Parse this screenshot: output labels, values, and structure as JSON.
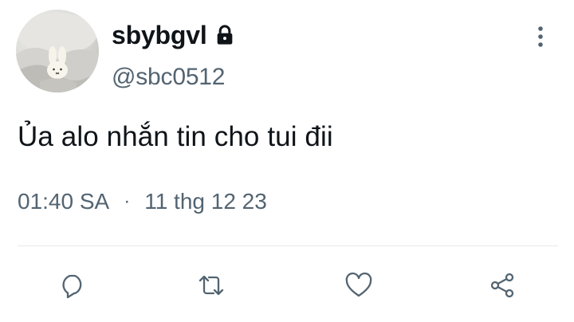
{
  "author": {
    "display_name": "sbybgvl",
    "handle": "@sbc0512",
    "protected": true,
    "avatar": "stuffed-bunny-in-bed-photo"
  },
  "tweet": {
    "text": "Ủa alo nhắn tin cho tui đii",
    "time": "01:40 SA",
    "separator": "·",
    "date": "11 thg 12 23"
  },
  "icons": {
    "more": "more-vertical-icon",
    "reply": "reply-icon",
    "retweet": "retweet-icon",
    "like": "heart-icon",
    "share": "share-icon",
    "lock": "lock-icon"
  },
  "colors": {
    "text_primary": "#0f1419",
    "text_secondary": "#536471",
    "divider": "#e7e9ea",
    "background": "#ffffff"
  }
}
